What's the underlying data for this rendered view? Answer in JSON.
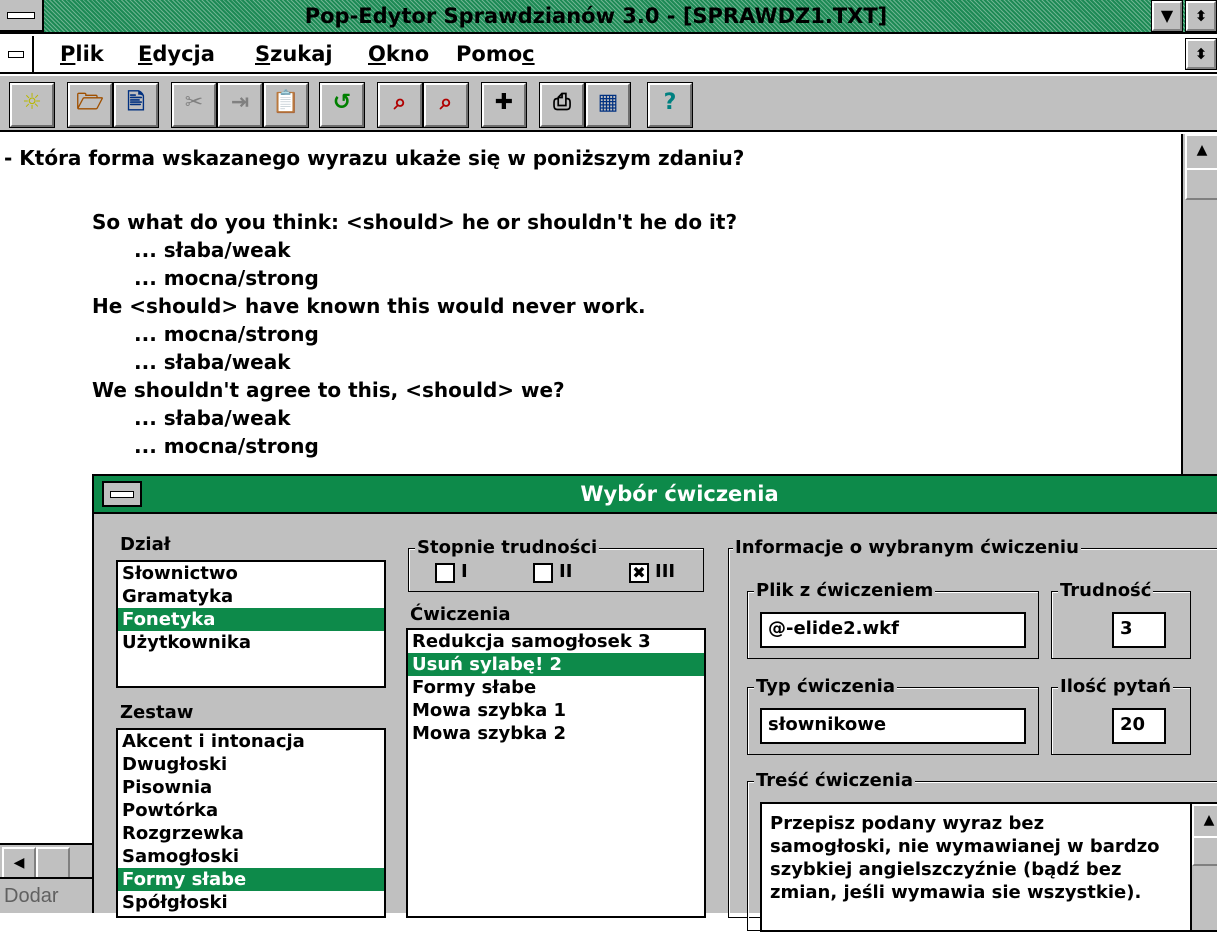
{
  "window": {
    "title": "Pop-Edytor Sprawdzianów 3.0 - [SPRAWDZ1.TXT]",
    "min_glyph": "▼",
    "restore_glyph": "⬍"
  },
  "menu": {
    "items": [
      {
        "hot": "P",
        "rest": "lik"
      },
      {
        "hot": "E",
        "rest": "dycja"
      },
      {
        "hot": "S",
        "rest": "zukaj"
      },
      {
        "hot": "O",
        "rest": "kno"
      },
      {
        "pre": "Pomo",
        "hot": "c",
        "rest": ""
      }
    ]
  },
  "toolbar": {
    "buttons": [
      {
        "name": "new-file-icon",
        "glyph": "☼",
        "color": "#b8b800"
      },
      {
        "name": "open-file-icon",
        "glyph": "🗁",
        "color": "#a05000"
      },
      {
        "name": "save-file-icon",
        "glyph": "🖹",
        "color": "#003080"
      },
      {
        "name": "cut-icon",
        "glyph": "✂",
        "color": "#808080"
      },
      {
        "name": "copy-icon",
        "glyph": "⇥",
        "color": "#808080"
      },
      {
        "name": "paste-icon",
        "glyph": "📋",
        "color": "#003080"
      },
      {
        "name": "undo-icon",
        "glyph": "↺",
        "color": "#008000"
      },
      {
        "name": "find-icon",
        "glyph": "⌕",
        "color": "#b00000"
      },
      {
        "name": "find-next-icon",
        "glyph": "⌕",
        "color": "#b00000"
      },
      {
        "name": "insert-icon",
        "glyph": "✚",
        "color": "#000000"
      },
      {
        "name": "print-icon",
        "glyph": "⎙",
        "color": "#000000"
      },
      {
        "name": "preview-icon",
        "glyph": "▦",
        "color": "#003080"
      },
      {
        "name": "help-icon",
        "glyph": "?",
        "color": "#008080"
      }
    ]
  },
  "document": {
    "lines": [
      "- Która forma wskazanego wyrazu ukaże się w poniższym zdaniu?",
      "",
      "So what do you think: <should> he or shouldn't he do it?",
      "... słaba/weak",
      "... mocna/strong",
      "He <should> have known this would never work.",
      "... mocna/strong",
      "... słaba/weak",
      "We shouldn't agree to this, <should> we?",
      "... słaba/weak",
      "... mocna/strong"
    ],
    "scroll_up_glyph": "▲",
    "hscroll_left_glyph": "◀"
  },
  "status": {
    "text": "Dodar"
  },
  "dialog": {
    "title": "Wybór ćwiczenia",
    "dzial_label": "Dział",
    "dzial_items": [
      "Słownictwo",
      "Gramatyka",
      "Fonetyka",
      "Użytkownika"
    ],
    "dzial_selected": 2,
    "zestaw_label": "Zestaw",
    "zestaw_items": [
      "Akcent i intonacja",
      "Dwugłoski",
      "Pisownia",
      "Powtórka",
      "Rozgrzewka",
      "Samogłoski",
      "Formy słabe",
      "Spółgłoski"
    ],
    "zestaw_selected": 6,
    "stopnie_label": "Stopnie trudności",
    "levels": [
      {
        "label": "I",
        "checked": false
      },
      {
        "label": "II",
        "checked": false
      },
      {
        "label": "III",
        "checked": true
      }
    ],
    "cwiczenia_label": "Ćwiczenia",
    "cwiczenia_items": [
      "Redukcja samogłosek 3",
      "Usuń sylabę! 2",
      "Formy słabe",
      "Mowa szybka 1",
      "Mowa szybka 2"
    ],
    "cwiczenia_selected": 1,
    "info_label": "Informacje o wybranym ćwiczeniu",
    "plik_label": "Plik z ćwiczeniem",
    "plik_value": "@-elide2.wkf",
    "trudnosc_label": "Trudność",
    "trudnosc_value": "3",
    "typ_label": "Typ ćwiczenia",
    "typ_value": "słownikowe",
    "ilosc_label": "Ilość pytań",
    "ilosc_value": "20",
    "tresc_label": "Treść ćwiczenia",
    "tresc_value": "Przepisz podany wyraz bez samogłoski, nie wymawianej w bardzo szybkiej angielszczyźnie (bądź bez zmian, jeśli wymawia sie wszystkie)."
  },
  "colors": {
    "selection": "#0d8a4a",
    "title_bar": "#1d8a55",
    "face": "#c0c0c0"
  }
}
